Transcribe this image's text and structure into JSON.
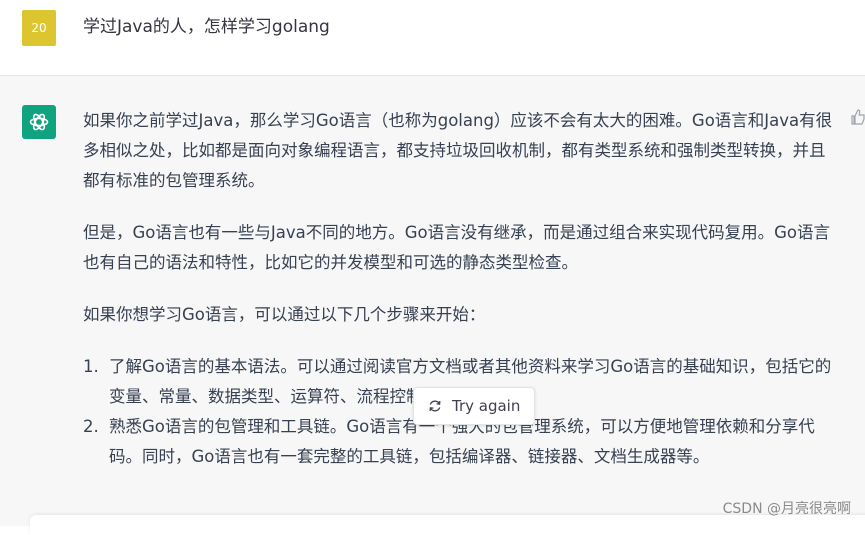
{
  "user_message": {
    "avatar_label": "20",
    "text": "学过Java的人，怎样学习golang"
  },
  "assistant_message": {
    "avatar_icon": "openai-logo-icon",
    "paragraphs": [
      "如果你之前学过Java，那么学习Go语言（也称为golang）应该不会有太大的困难。Go语言和Java有很多相似之处，比如都是面向对象编程语言，都支持垃圾回收机制，都有类型系统和强制类型转换，并且都有标准的包管理系统。",
      "但是，Go语言也有一些与Java不同的地方。Go语言没有继承，而是通过组合来实现代码复用。Go语言也有自己的语法和特性，比如它的并发模型和可选的静态类型检查。",
      "如果你想学习Go语言，可以通过以下几个步骤来开始："
    ],
    "list_items": [
      {
        "number": "1.",
        "text": "了解Go语言的基本语法。可以通过阅读官方文档或者其他资料来学习Go语言的基础知识，包括它的变量、常量、数据类型、运算符、流程控制语句等。"
      },
      {
        "number": "2.",
        "text": "熟悉Go语言的包管理和工具链。Go语言有一个强大的包管理系统，可以方便地管理依赖和分享代码。同时，Go语言也有一套完整的工具链，包括编译器、链接器、文档生成器等。"
      }
    ]
  },
  "try_again_button": {
    "label": "Try again",
    "icon": "refresh-icon"
  },
  "watermark": "CSDN @月亮很亮啊",
  "colors": {
    "user_avatar": "#ddc52f",
    "bot_avatar": "#10a37f",
    "assistant_bg": "#f7f7f8"
  }
}
